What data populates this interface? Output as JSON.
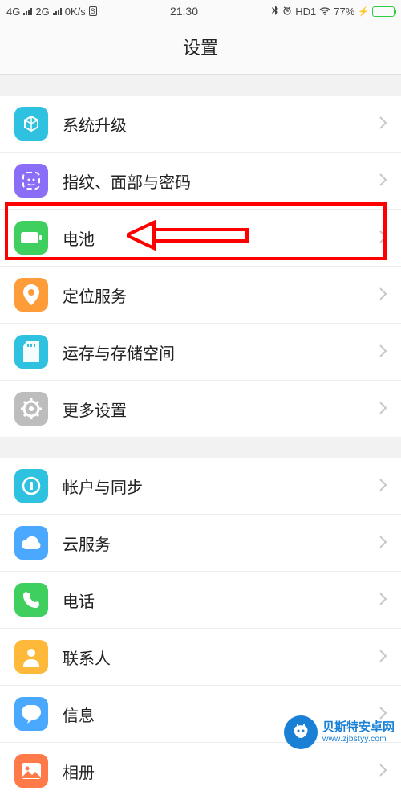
{
  "status": {
    "signal1": "4G",
    "signal2": "2G",
    "speed": "0K/s",
    "time": "21:30",
    "audio": "HD1",
    "battery_pct": "77%"
  },
  "header": {
    "title": "设置"
  },
  "groups": [
    {
      "items": [
        {
          "id": "system-upgrade",
          "label": "系统升级",
          "icon": "cube",
          "color": "#2fc1e0"
        },
        {
          "id": "biometrics",
          "label": "指纹、面部与密码",
          "icon": "face",
          "color": "#8c6df7"
        },
        {
          "id": "battery",
          "label": "电池",
          "icon": "battery",
          "color": "#3ecf5f"
        },
        {
          "id": "location",
          "label": "定位服务",
          "icon": "pin",
          "color": "#ff9c3a"
        },
        {
          "id": "storage",
          "label": "运存与存储空间",
          "icon": "sd",
          "color": "#2fc1e0"
        },
        {
          "id": "more",
          "label": "更多设置",
          "icon": "gear",
          "color": "#bdbdbd"
        }
      ]
    },
    {
      "items": [
        {
          "id": "account-sync",
          "label": "帐户与同步",
          "icon": "sync",
          "color": "#2fc1e0"
        },
        {
          "id": "cloud",
          "label": "云服务",
          "icon": "cloud",
          "color": "#4aa9ff"
        },
        {
          "id": "phone",
          "label": "电话",
          "icon": "phone",
          "color": "#3ecf5f"
        },
        {
          "id": "contacts",
          "label": "联系人",
          "icon": "person",
          "color": "#ffb93a"
        },
        {
          "id": "messages",
          "label": "信息",
          "icon": "msg",
          "color": "#4aa9ff"
        },
        {
          "id": "gallery",
          "label": "相册",
          "icon": "photo",
          "color": "#ff7a48"
        }
      ]
    }
  ],
  "watermark": {
    "line1": "贝斯特安卓网",
    "line2": "www.zjbstyy.com"
  }
}
